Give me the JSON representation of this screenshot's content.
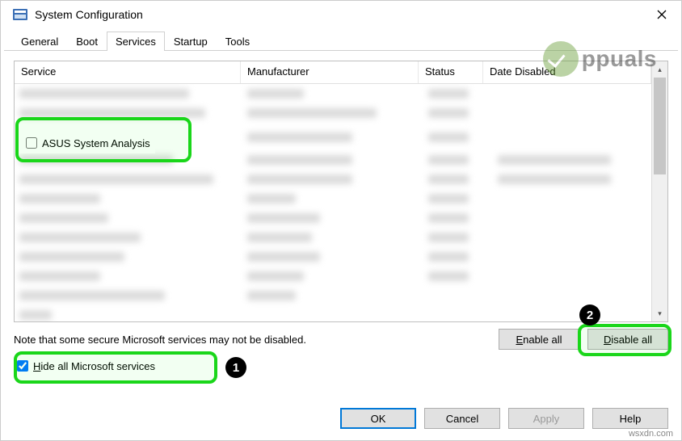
{
  "window": {
    "title": "System Configuration"
  },
  "tabs": {
    "general": "General",
    "boot": "Boot",
    "services": "Services",
    "startup": "Startup",
    "tools": "Tools",
    "active": "services"
  },
  "columns": {
    "service": "Service",
    "manufacturer": "Manufacturer",
    "status": "Status",
    "date_disabled": "Date Disabled"
  },
  "visible_service": {
    "name": "ASUS System Analysis",
    "checked": false
  },
  "note": "Note that some secure Microsoft services may not be disabled.",
  "buttons": {
    "enable_all": "Enable all",
    "disable_all": "Disable all",
    "ok": "OK",
    "cancel": "Cancel",
    "apply": "Apply",
    "help": "Help"
  },
  "hide_checkbox": {
    "label": "Hide all Microsoft services",
    "checked": true
  },
  "watermark": {
    "brand": "ppuals",
    "footer": "wsxdn.com"
  },
  "annotations": {
    "badge1": "1",
    "badge2": "2"
  }
}
